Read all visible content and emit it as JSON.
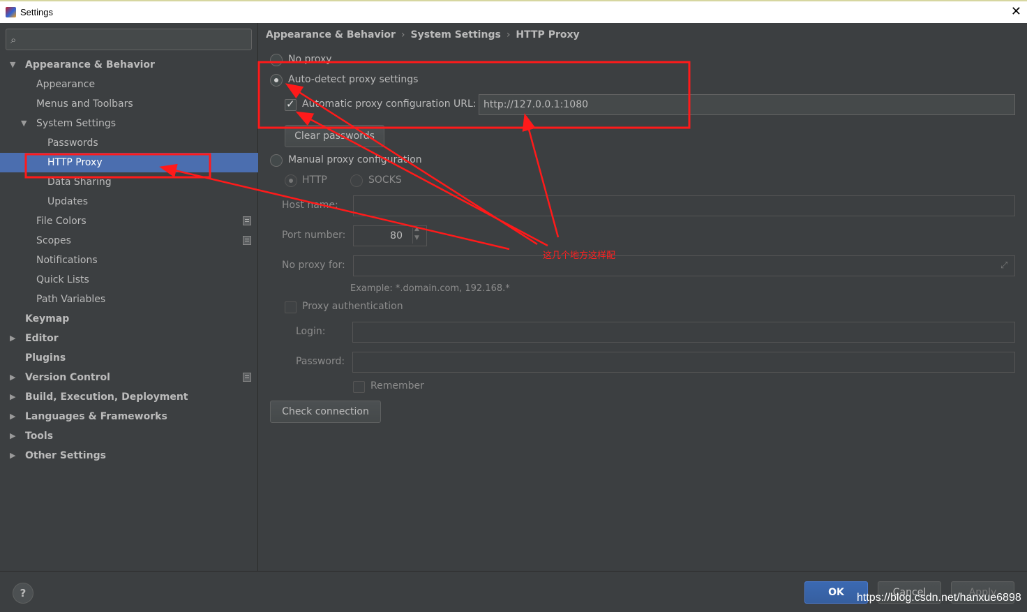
{
  "window": {
    "title": "Settings",
    "close_glyph": "✕"
  },
  "search": {
    "placeholder": ""
  },
  "sidebar": {
    "items": [
      {
        "label": "Appearance & Behavior"
      },
      {
        "label": "Appearance"
      },
      {
        "label": "Menus and Toolbars"
      },
      {
        "label": "System Settings"
      },
      {
        "label": "Passwords"
      },
      {
        "label": "HTTP Proxy"
      },
      {
        "label": "Data Sharing"
      },
      {
        "label": "Updates"
      },
      {
        "label": "File Colors"
      },
      {
        "label": "Scopes"
      },
      {
        "label": "Notifications"
      },
      {
        "label": "Quick Lists"
      },
      {
        "label": "Path Variables"
      },
      {
        "label": "Keymap"
      },
      {
        "label": "Editor"
      },
      {
        "label": "Plugins"
      },
      {
        "label": "Version Control"
      },
      {
        "label": "Build, Execution, Deployment"
      },
      {
        "label": "Languages & Frameworks"
      },
      {
        "label": "Tools"
      },
      {
        "label": "Other Settings"
      }
    ]
  },
  "breadcrumb": [
    "Appearance & Behavior",
    "System Settings",
    "HTTP Proxy"
  ],
  "proxy": {
    "no_proxy": "No proxy",
    "auto_detect": "Auto-detect proxy settings",
    "auto_config_label": "Automatic proxy configuration URL:",
    "auto_config_url": "http://127.0.0.1:1080",
    "clear_passwords": "Clear passwords",
    "manual": "Manual proxy configuration",
    "http": "HTTP",
    "socks": "SOCKS",
    "host_label": "Host name:",
    "host_value": "",
    "port_label": "Port number:",
    "port_value": "80",
    "no_proxy_for_label": "No proxy for:",
    "no_proxy_for_value": "",
    "example": "Example: *.domain.com, 192.168.*",
    "proxy_auth": "Proxy authentication",
    "login_label": "Login:",
    "password_label": "Password:",
    "remember": "Remember",
    "check_connection": "Check connection"
  },
  "footer": {
    "help": "?",
    "ok": "OK",
    "cancel": "Cancel",
    "apply": "Apply",
    "watermark": "https://blog.csdn.net/hanxue6898"
  },
  "annotation": {
    "text": "这几个地方这样配",
    "color": "#ff1a1a"
  },
  "colors": {
    "background": "#3c3f41",
    "selection": "#4b6eaf",
    "primary_button": "#365f9f"
  }
}
